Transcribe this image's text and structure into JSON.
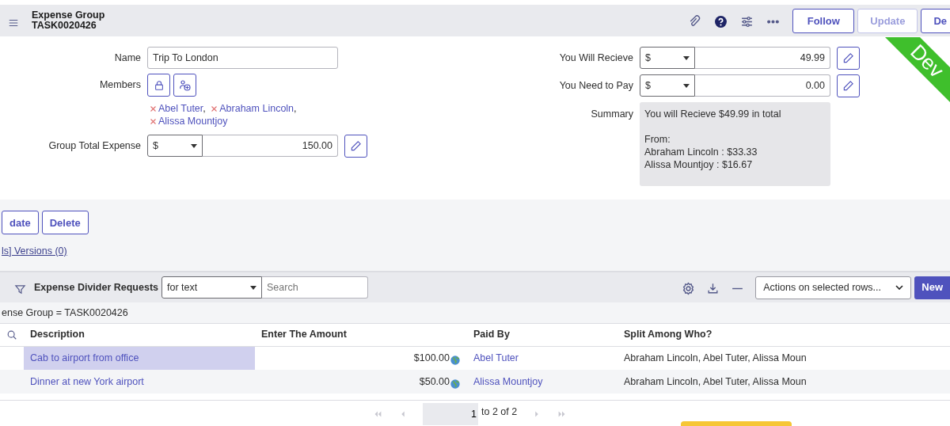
{
  "header": {
    "title": "Expense Group",
    "number": "TASK0020426",
    "buttons": [
      {
        "label": "Follow",
        "disabled": false
      },
      {
        "label": "Update",
        "disabled": true
      },
      {
        "label": "De",
        "disabled": false
      }
    ]
  },
  "env_ribbon": {
    "label": "Dev"
  },
  "form": {
    "name": {
      "label": "Name",
      "value": "Trip To London"
    },
    "members": {
      "label": "Members",
      "people": [
        {
          "name": "Abel Tuter",
          "separator": ","
        },
        {
          "name": "Abraham Lincoln",
          "separator": ","
        },
        {
          "name": "Alissa Mountjoy"
        }
      ]
    },
    "left_currency": [
      {
        "label": "Group Total Expense",
        "currency": "$",
        "amount": "150.00"
      }
    ],
    "right_currency": [
      {
        "label": "You Will Recieve",
        "currency": "$",
        "amount": "49.99"
      },
      {
        "label": "You Need to Pay",
        "currency": "$",
        "amount": "0.00"
      }
    ],
    "summary": {
      "label": "Summary",
      "text": "You will Recieve $49.99 in total\n\nFrom:\nAbraham Lincoln : $33.33\nAlissa Mountjoy : $16.67"
    }
  },
  "form_buttons": [
    "date",
    "Delete"
  ],
  "related_link": "ls] Versions (0)",
  "list": {
    "title": "Expense Divider Requests",
    "filter_select": "for text",
    "search": {
      "placeholder": "Search"
    },
    "actions_select": "Actions on selected rows...",
    "new_button": "New",
    "breadcrumb": "ense Group = TASK0020426",
    "columns": [
      "Description",
      "Enter The Amount",
      "Paid By",
      "Split Among Who?"
    ],
    "rows": [
      {
        "description": "Cab to airport from office",
        "amount": "$100.00",
        "paid_by": "Abel Tuter",
        "split": "Abraham Lincoln, Abel Tuter, Alissa Moun",
        "selected": true
      },
      {
        "description": "Dinner at new York airport",
        "amount": "$50.00",
        "paid_by": "Alissa Mountjoy",
        "split": "Abraham Lincoln, Abel Tuter, Alissa Moun",
        "selected": false
      }
    ],
    "pagination": {
      "page": "1",
      "range": "to 2 of 2"
    }
  }
}
